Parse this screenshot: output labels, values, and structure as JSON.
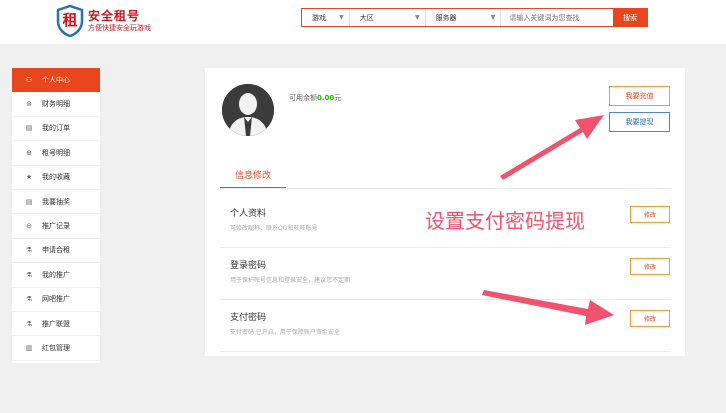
{
  "logo": {
    "char": "租",
    "title": "安全租号",
    "subtitle": "方便快捷安全玩游戏"
  },
  "search": {
    "game_label": "游戏",
    "region_label": "大区",
    "server_label": "服务器",
    "placeholder": "请输入关键词为您查找",
    "button_label": "搜索"
  },
  "sidebar": {
    "items": [
      {
        "label": "个人中心",
        "icon": "user-icon",
        "glyph": "⚇"
      },
      {
        "label": "财务明细",
        "icon": "finance-icon",
        "glyph": "⊜"
      },
      {
        "label": "我的订单",
        "icon": "order-icon",
        "glyph": "▤"
      },
      {
        "label": "租号明细",
        "icon": "rent-icon",
        "glyph": "⊕"
      },
      {
        "label": "我的收藏",
        "icon": "star-icon",
        "glyph": "★"
      },
      {
        "label": "我要抽奖",
        "icon": "lottery-icon",
        "glyph": "▤"
      },
      {
        "label": "推广记录",
        "icon": "promo-record-icon",
        "glyph": "⊖"
      },
      {
        "label": "申请合租",
        "icon": "share-rent-icon",
        "glyph": "⚗"
      },
      {
        "label": "我的推广",
        "icon": "my-promo-icon",
        "glyph": "⚗"
      },
      {
        "label": "网吧推广",
        "icon": "netcafe-icon",
        "glyph": "⚗"
      },
      {
        "label": "推广联盟",
        "icon": "alliance-icon",
        "glyph": "⚗"
      },
      {
        "label": "红包管理",
        "icon": "redpacket-icon",
        "glyph": "▥"
      }
    ]
  },
  "account": {
    "balance_label": "可用余额",
    "balance_value": "0.00",
    "balance_unit": "元",
    "recharge_label": "我要充值",
    "withdraw_label": "我要提现"
  },
  "tab": {
    "label": "信息修改"
  },
  "rows": [
    {
      "title": "个人资料",
      "desc": "可修改昵称、联系QQ和旺旺账号",
      "button": "修改"
    },
    {
      "title": "登录密码",
      "desc": "用于保护账号信息和登录安全，建议您不定期",
      "button": "修改"
    },
    {
      "title": "支付密码",
      "desc": "支付密码 已开启，用于保障账户资金安全",
      "button": "修改"
    }
  ],
  "annotation": {
    "text": "设置支付密码提现",
    "color": "#f1536e"
  },
  "colors": {
    "accent": "#e8461e",
    "balance": "#2db400",
    "withdraw": "#2b6cb0"
  }
}
